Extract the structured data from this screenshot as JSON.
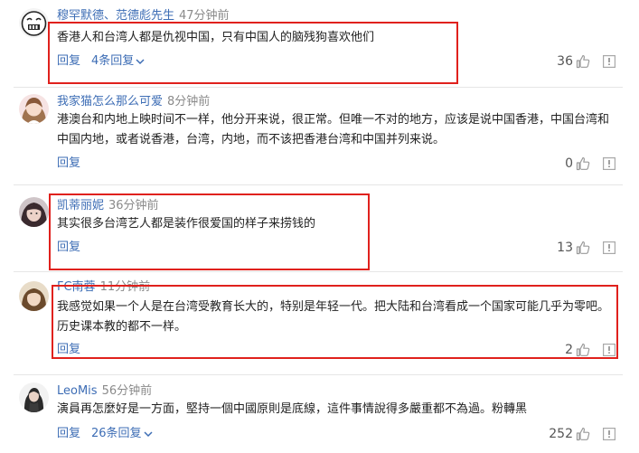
{
  "comments": [
    {
      "username": "穆罕默德、范德彪先生",
      "time": "47分钟前",
      "text": "香港人和台湾人都是仇视中国，只有中国人的脑残狗喜欢他们",
      "reply": "回复",
      "replies_link": "4条回复",
      "likes": "36"
    },
    {
      "username": "我家猫怎么那么可爱",
      "time": "8分钟前",
      "text": "港澳台和内地上映时间不一样，他分开来说，很正常。但唯一不对的地方，应该是说中国香港，中国台湾和中国内地，或者说香港，台湾，内地，而不该把香港台湾和中国并列来说。",
      "reply": "回复",
      "likes": "0"
    },
    {
      "username": "凯蒂丽妮",
      "time": "36分钟前",
      "text": "其实很多台湾艺人都是装作很爱国的样子来捞钱的",
      "reply": "回复",
      "likes": "13"
    },
    {
      "username": "FC南蓉",
      "time": "11分钟前",
      "text": "我感觉如果一个人是在台湾受教育长大的，特别是年轻一代。把大陆和台湾看成一个国家可能几乎为零吧。历史课本教的都不一样。",
      "reply": "回复",
      "likes": "2"
    },
    {
      "username": "LeoMis",
      "time": "56分钟前",
      "text": "演員再怎麼好是一方面，堅持一個中國原則是底線，這件事情說得多嚴重都不為過。粉轉黑",
      "reply": "回复",
      "replies_link": "26条回复",
      "likes": "252"
    }
  ],
  "colors": {
    "username": "#3d6db5",
    "timestamp": "#8a8a8a",
    "highlight": "#e0211d",
    "divider": "#e6e6e6"
  },
  "icons": {
    "like": "thumbs-up-icon",
    "report": "report-icon",
    "expand": "chevron-down-icon"
  }
}
